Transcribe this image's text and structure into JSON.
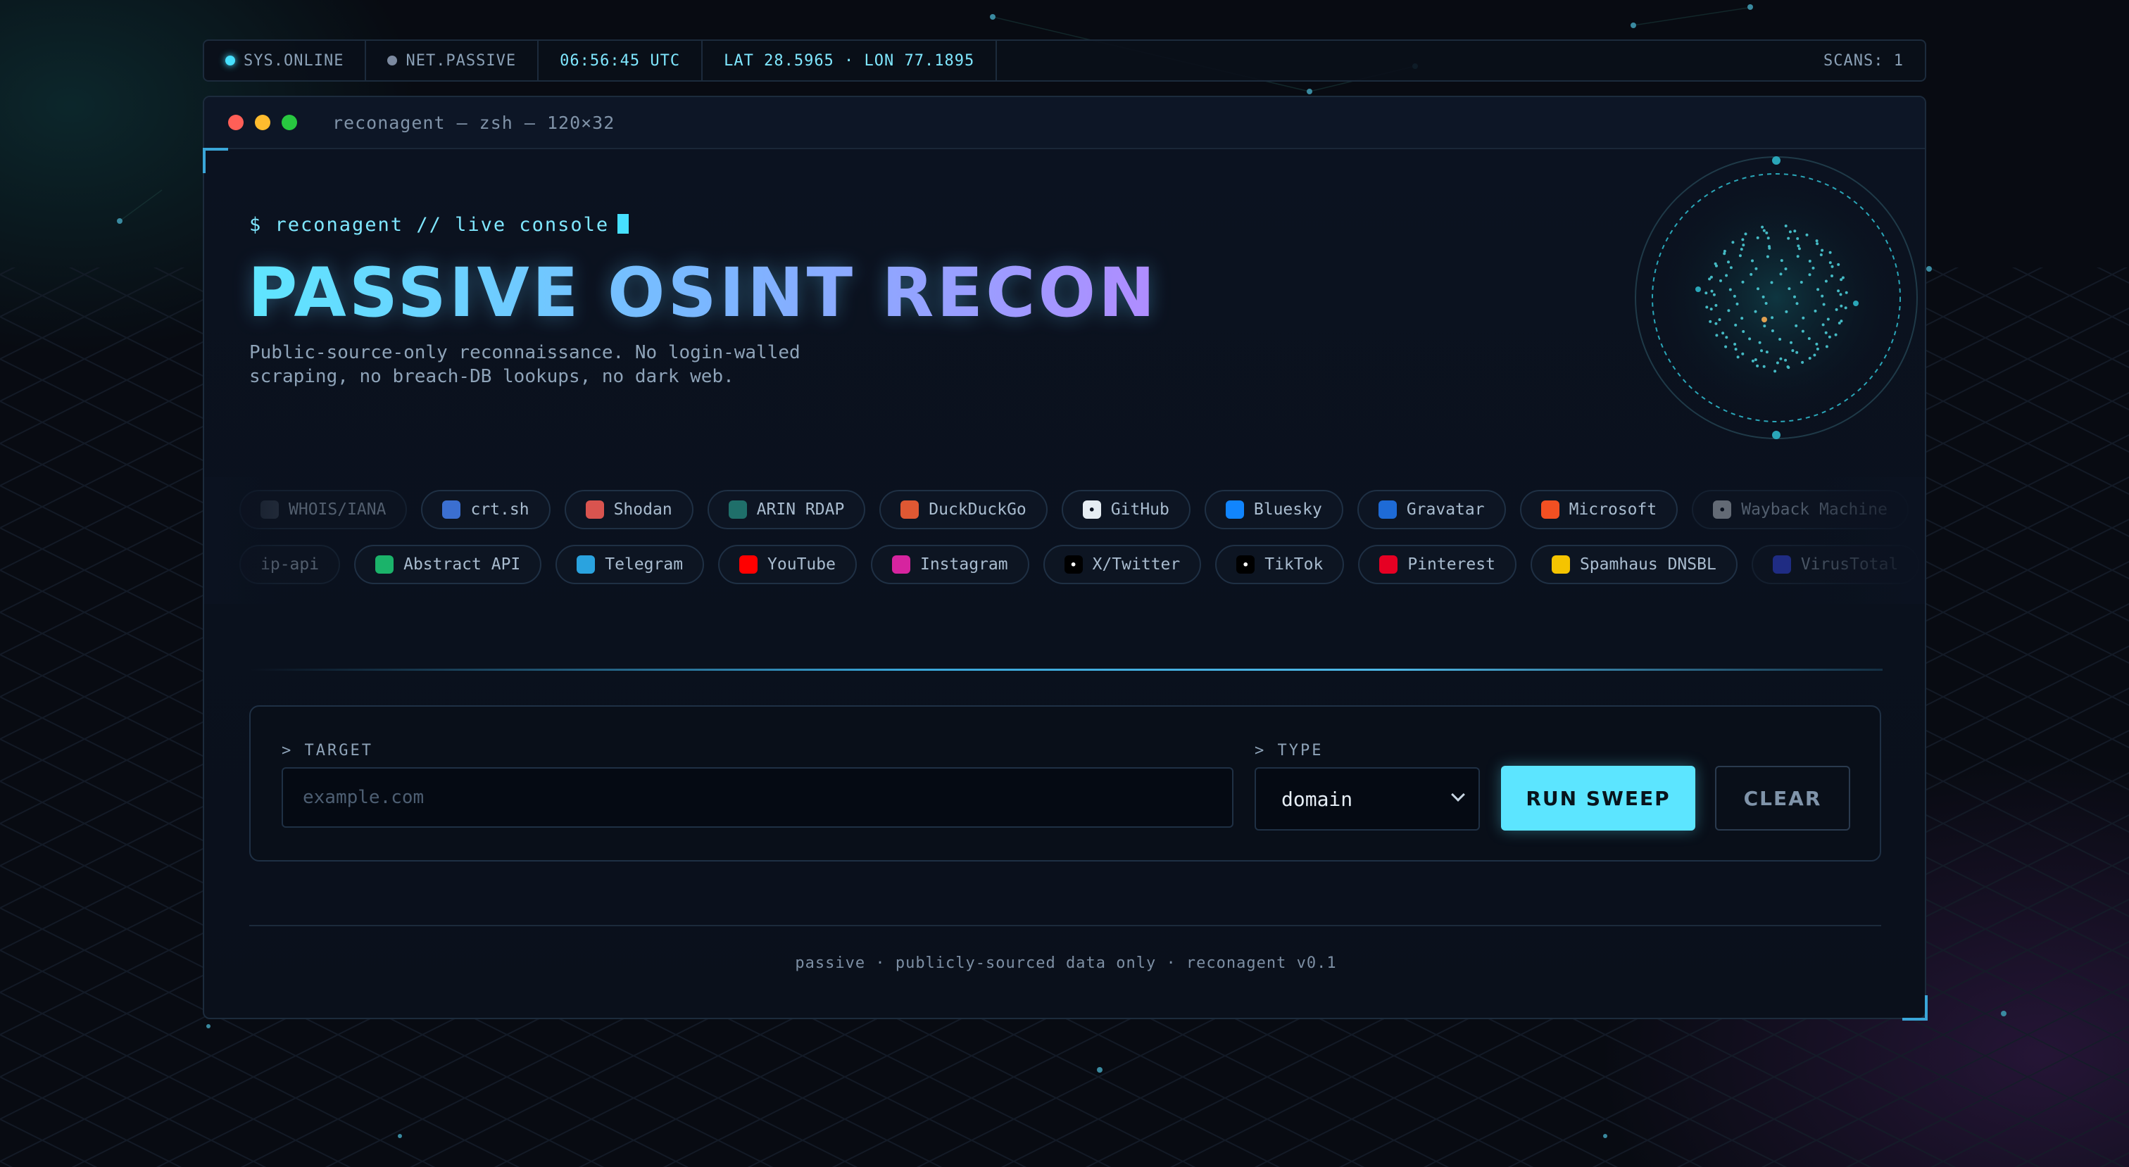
{
  "status_bar": {
    "sys": "SYS.ONLINE",
    "net": "NET.PASSIVE",
    "time": "06:56:45 UTC",
    "coords": "LAT 28.5965 · LON 77.1895",
    "scans": "SCANS: 1"
  },
  "window": {
    "title": "reconagent — zsh — 120×32"
  },
  "hero": {
    "prompt": "$ reconagent // live console",
    "title": "PASSIVE OSINT RECON",
    "subtitle": "Public-source-only reconnaissance. No login-walled scraping, no breach-DB lookups, no dark web."
  },
  "sources_row1": [
    {
      "label": "WHOIS/IANA",
      "icon": "globe-icon",
      "color": "#3d4a5a"
    },
    {
      "label": "crt.sh",
      "icon": "cert-icon",
      "color": "#3b6fd1"
    },
    {
      "label": "Shodan",
      "icon": "shodan-icon",
      "color": "#d9544f"
    },
    {
      "label": "ARIN RDAP",
      "icon": "arin-icon",
      "color": "#1f6f6a"
    },
    {
      "label": "DuckDuckGo",
      "icon": "duckduckgo-icon",
      "color": "#de5833"
    },
    {
      "label": "GitHub",
      "icon": "github-icon",
      "color": "#e6edf3"
    },
    {
      "label": "Bluesky",
      "icon": "bluesky-icon",
      "color": "#1185fe"
    },
    {
      "label": "Gravatar",
      "icon": "gravatar-icon",
      "color": "#1e6bd6"
    },
    {
      "label": "Microsoft",
      "icon": "microsoft-icon",
      "color": "#f25022"
    },
    {
      "label": "Wayback Machine",
      "icon": "archive-icon",
      "color": "#cfd6de"
    }
  ],
  "sources_row2": [
    {
      "label": "ip-api",
      "icon": "",
      "color": ""
    },
    {
      "label": "Abstract API",
      "icon": "abstract-icon",
      "color": "#1bb36a"
    },
    {
      "label": "Telegram",
      "icon": "telegram-icon",
      "color": "#2aa3df"
    },
    {
      "label": "YouTube",
      "icon": "youtube-icon",
      "color": "#ff0000"
    },
    {
      "label": "Instagram",
      "icon": "instagram-icon",
      "color": "#d6249f"
    },
    {
      "label": "X/Twitter",
      "icon": "x-icon",
      "color": "#000000"
    },
    {
      "label": "TikTok",
      "icon": "tiktok-icon",
      "color": "#000000"
    },
    {
      "label": "Pinterest",
      "icon": "pinterest-icon",
      "color": "#e60023"
    },
    {
      "label": "Spamhaus DNSBL",
      "icon": "spamhaus-icon",
      "color": "#f5c400"
    },
    {
      "label": "VirusTotal",
      "icon": "virustotal-icon",
      "color": "#394eff"
    }
  ],
  "form": {
    "target_label": "> TARGET",
    "target_placeholder": "example.com",
    "target_value": "",
    "type_label": "> TYPE",
    "type_value": "domain",
    "run_label": "RUN SWEEP",
    "clear_label": "CLEAR"
  },
  "footer": {
    "text": "passive · publicly-sourced data only · reconagent v0.1"
  },
  "colors": {
    "accent": "#5ce5ff",
    "background": "#080b12"
  }
}
